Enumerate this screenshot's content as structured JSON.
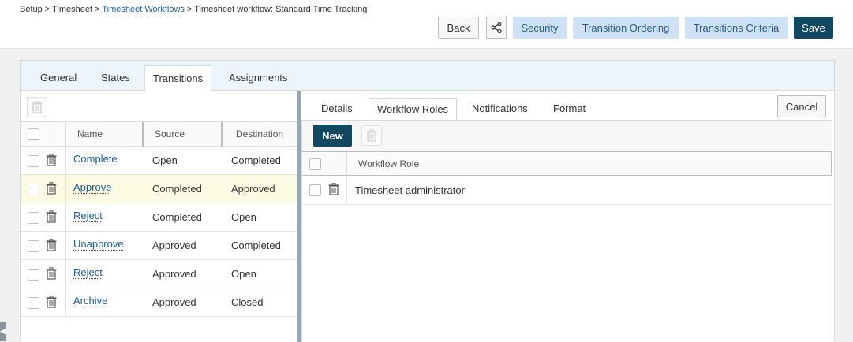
{
  "breadcrumb": {
    "part1": "Setup > Timesheet > ",
    "link": "Timesheet Workflows",
    "part2": " > Timesheet workflow: Standard Time Tracking"
  },
  "header": {
    "back_label": "Back",
    "security_label": "Security",
    "transition_ordering_label": "Transition Ordering",
    "transitions_criteria_label": "Transitions Criteria",
    "save_label": "Save"
  },
  "tabs": {
    "general": "General",
    "states": "States",
    "transitions": "Transitions",
    "assignments": "Assignments"
  },
  "transitions_table": {
    "columns": {
      "name": "Name",
      "source": "Source",
      "destination": "Destination"
    },
    "rows": [
      {
        "name": "Complete",
        "source": "Open",
        "destination": "Completed"
      },
      {
        "name": "Approve",
        "source": "Completed",
        "destination": "Approved"
      },
      {
        "name": "Reject",
        "source": "Completed",
        "destination": "Open"
      },
      {
        "name": "Unapprove",
        "source": "Approved",
        "destination": "Completed"
      },
      {
        "name": "Reject",
        "source": "Approved",
        "destination": "Open"
      },
      {
        "name": "Archive",
        "source": "Approved",
        "destination": "Closed"
      }
    ]
  },
  "detail": {
    "tabs": {
      "details": "Details",
      "workflow_roles": "Workflow Roles",
      "notifications": "Notifications",
      "format": "Format"
    },
    "cancel_label": "Cancel",
    "new_label": "New",
    "roles_table": {
      "column": "Workflow Role",
      "rows": [
        {
          "role": "Timesheet administrator"
        }
      ]
    }
  },
  "colors": {
    "primary": "#104761",
    "light_button": "#cfe2f5",
    "link": "#1d5d9b",
    "highlight_row": "#fbfbe3"
  }
}
